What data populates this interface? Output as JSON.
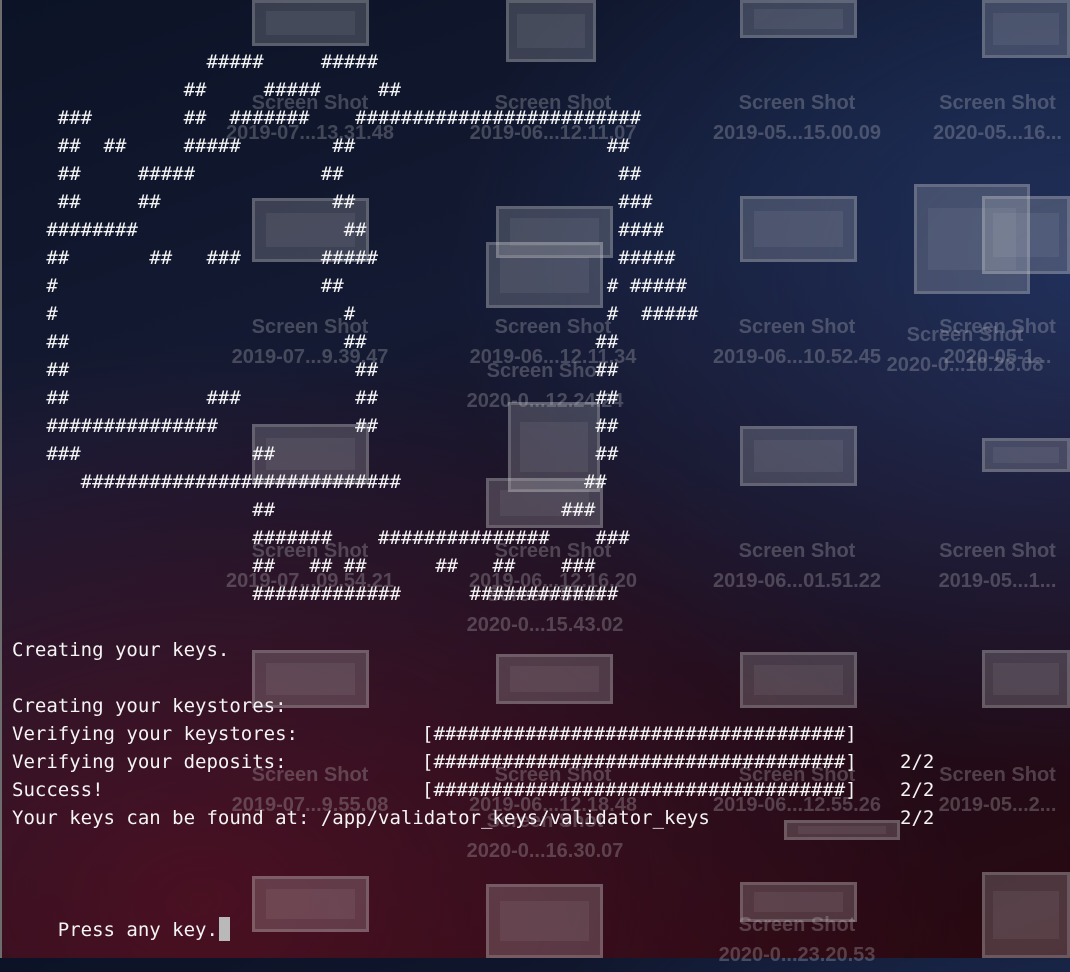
{
  "desktop": {
    "items": [
      {
        "line1": "Screen Shot",
        "line2": "2019-07...13.31.48"
      },
      {
        "line1": "Screen Shot",
        "line2": "2019-06...12.11.07"
      },
      {
        "line1": "Screen Shot",
        "line2": "2019-05...15.00.09"
      },
      {
        "line1": "Screen Shot",
        "line2": "2020-05...16..."
      },
      {
        "line1": "Screen Shot",
        "line2": "2019-07...9.39.47"
      },
      {
        "line1": "Screen Shot",
        "line2": "2019-06...12.11.34"
      },
      {
        "line1": "Screen Shot",
        "line2": "2019-06...10.52.45"
      },
      {
        "line1": "Screen Shot",
        "line2": "2020-05-1..."
      },
      {
        "line1": "Screen Shot",
        "line2": "2020-0...12.24.24"
      },
      {
        "line1": "Screen Shot",
        "line2": "2020-0...10.26.08"
      },
      {
        "line1": "Screen Shot",
        "line2": "2019-07...09.54.21"
      },
      {
        "line1": "Screen Shot",
        "line2": "2019-06...12.16.20"
      },
      {
        "line1": "Screen Shot",
        "line2": "2019-06...01.51.22"
      },
      {
        "line1": "Screen Shot",
        "line2": "2019-05...1..."
      },
      {
        "line1": "Screen Shot",
        "line2": "2020-0...15.43.02"
      },
      {
        "line1": "Screen Shot",
        "line2": "2019-07...9.55.08"
      },
      {
        "line1": "Screen Shot",
        "line2": "2019-06...12.18.48"
      },
      {
        "line1": "Screen Shot",
        "line2": "2019-06...12.55.26"
      },
      {
        "line1": "Screen Shot",
        "line2": "2019-05...2..."
      },
      {
        "line1": "Screen Shot",
        "line2": "2020-0...16.30.07"
      },
      {
        "line1": "Screen Shot",
        "line2": "2020-0...23.20.53"
      }
    ]
  },
  "terminal": {
    "ascii_art": "                 #####     #####\n               ##     #####     ##\n    ###        ##  #######    #########################\n    ##  ##     #####        ##                      ##\n    ##     #####           ##                        ##\n    ##     ##               ##                       ###\n   ########                  ##                      ####\n   ##       ##   ###       #####                     #####\n   #                       ##                       # #####\n   #                         #                      #  #####\n   ##                        ##                    ##\n   ##                         ##                   ##\n   ##            ###          ##                   ##\n   ###############            ##                   ##\n   ###               ##                            ##\n      ############################                ##\n                     ##                         ###\n                     #######    ###############    ###\n                     ##   ## ##      ##   ##    ###\n                     #############      #############",
    "lines": {
      "creating_keys": "Creating your keys.",
      "success": "Success!",
      "keys_found": "Your keys can be found at: /app/validator_keys/validator_keys",
      "press_any_key": "Press any key."
    },
    "progress": [
      {
        "label": "Creating your keystores:",
        "bar": "[####################################]",
        "count": "2/2",
        "done": 2,
        "total": 2
      },
      {
        "label": "Verifying your keystores:",
        "bar": "[####################################]",
        "count": "2/2",
        "done": 2,
        "total": 2
      },
      {
        "label": "Verifying your deposits:",
        "bar": "[####################################]",
        "count": "2/2",
        "done": 2,
        "total": 2
      }
    ]
  }
}
